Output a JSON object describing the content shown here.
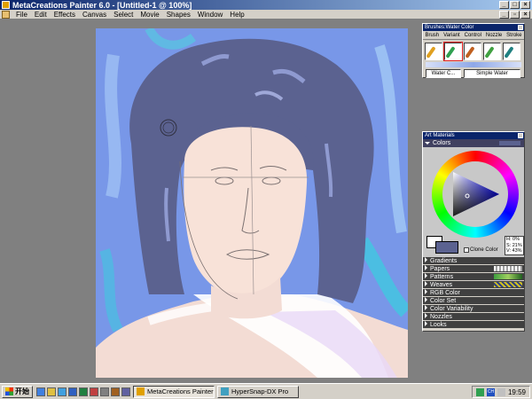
{
  "window": {
    "title": "MetaCreations Painter 6.0 - [Untitled-1 @ 100%]"
  },
  "menubar": [
    "File",
    "Edit",
    "Effects",
    "Canvas",
    "Select",
    "Movie",
    "Shapes",
    "Window",
    "Help"
  ],
  "brushes_palette": {
    "title": "Brushes:Water Color",
    "tabs": [
      "Brush",
      "Variant",
      "Control",
      "Nozzle",
      "Stroke"
    ],
    "brush_icons": [
      "pencil-icon",
      "brush-icon",
      "brush-icon",
      "brush-icon",
      "brush-icon"
    ],
    "category": "Water C...",
    "variant": "Simple Water"
  },
  "art_materials": {
    "title": "Art Materials",
    "colors_label": "Colors",
    "clone_color_label": "Clone Color",
    "hsv": {
      "h": "H:  0%",
      "s": "S: 21%",
      "v": "V: 43%"
    },
    "secondary_color": "#5b6290",
    "sections": [
      {
        "label": "Gradients",
        "preview": "none"
      },
      {
        "label": "Papers",
        "preview": "papers"
      },
      {
        "label": "Patterns",
        "preview": "patterns"
      },
      {
        "label": "Weaves",
        "preview": "weaves"
      },
      {
        "label": "RGB Color",
        "preview": "none"
      },
      {
        "label": "Color Set",
        "preview": "none"
      },
      {
        "label": "Color Variability",
        "preview": "none"
      },
      {
        "label": "Nozzles",
        "preview": "none"
      },
      {
        "label": "Looks",
        "preview": "none"
      }
    ]
  },
  "taskbar": {
    "start_label": "开始",
    "tasks": [
      {
        "label": "MetaCreations Painter 6....",
        "active": true
      },
      {
        "label": "HyperSnap-DX Pro",
        "active": false
      }
    ],
    "clock": "19:59",
    "tray_badge": "CH"
  },
  "colors": {
    "title_bar": "#0a246a",
    "canvas_bg": "#7897e8",
    "hair": "#5b6290",
    "skin": "#f3dcd4"
  }
}
